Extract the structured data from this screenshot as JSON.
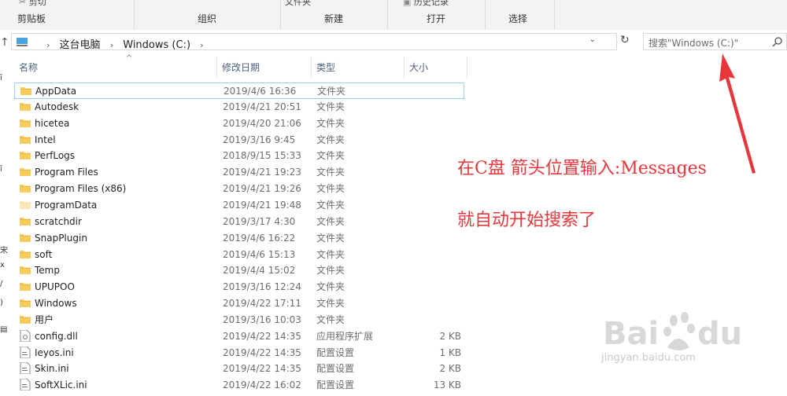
{
  "ribbon": {
    "groups": [
      {
        "label": "剪贴板",
        "top": "剪切"
      },
      {
        "label": "组织",
        "top": ""
      },
      {
        "label": "新建",
        "top": "文件夹"
      },
      {
        "label": "打开",
        "top": "历史记录"
      },
      {
        "label": "选择",
        "top": ""
      }
    ]
  },
  "address": {
    "crumbs": [
      "这台电脑",
      "Windows (C:)"
    ],
    "search_placeholder": "搜索\"Windows (C:)\""
  },
  "columns": {
    "name": "名称",
    "date": "修改日期",
    "type": "类型",
    "size": "大小"
  },
  "files": [
    {
      "name": "AppData",
      "date": "2019/4/6 16:36",
      "type": "文件夹",
      "size": "",
      "icon": "folder-icon"
    },
    {
      "name": "Autodesk",
      "date": "2019/4/21 20:51",
      "type": "文件夹",
      "size": "",
      "icon": "folder-icon"
    },
    {
      "name": "hicetea",
      "date": "2019/4/20 21:06",
      "type": "文件夹",
      "size": "",
      "icon": "folder-icon"
    },
    {
      "name": "Intel",
      "date": "2019/3/16 9:45",
      "type": "文件夹",
      "size": "",
      "icon": "folder-icon"
    },
    {
      "name": "PerfLogs",
      "date": "2018/9/15 15:33",
      "type": "文件夹",
      "size": "",
      "icon": "folder-icon"
    },
    {
      "name": "Program Files",
      "date": "2019/4/21 19:23",
      "type": "文件夹",
      "size": "",
      "icon": "folder-icon"
    },
    {
      "name": "Program Files (x86)",
      "date": "2019/4/21 19:26",
      "type": "文件夹",
      "size": "",
      "icon": "folder-icon"
    },
    {
      "name": "ProgramData",
      "date": "2019/4/21 19:48",
      "type": "文件夹",
      "size": "",
      "icon": "folder-icon"
    },
    {
      "name": "scratchdir",
      "date": "2019/3/17 4:30",
      "type": "文件夹",
      "size": "",
      "icon": "folder-icon"
    },
    {
      "name": "SnapPlugin",
      "date": "2019/4/6 16:22",
      "type": "文件夹",
      "size": "",
      "icon": "folder-icon"
    },
    {
      "name": "soft",
      "date": "2019/4/6 15:13",
      "type": "文件夹",
      "size": "",
      "icon": "folder-icon"
    },
    {
      "name": "Temp",
      "date": "2019/4/4 15:02",
      "type": "文件夹",
      "size": "",
      "icon": "folder-icon"
    },
    {
      "name": "UPUPOO",
      "date": "2019/3/16 12:24",
      "type": "文件夹",
      "size": "",
      "icon": "folder-icon"
    },
    {
      "name": "Windows",
      "date": "2019/4/22 17:11",
      "type": "文件夹",
      "size": "",
      "icon": "folder-icon"
    },
    {
      "name": "用户",
      "date": "2019/3/16 10:03",
      "type": "文件夹",
      "size": "",
      "icon": "folder-icon"
    },
    {
      "name": "config.dll",
      "date": "2019/4/22 14:35",
      "type": "应用程序扩展",
      "size": "2 KB",
      "icon": "dll-file-icon"
    },
    {
      "name": "Ieyos.ini",
      "date": "2019/4/22 14:35",
      "type": "配置设置",
      "size": "1 KB",
      "icon": "ini-file-icon"
    },
    {
      "name": "Skin.ini",
      "date": "2019/4/22 14:35",
      "type": "配置设置",
      "size": "2 KB",
      "icon": "ini-file-icon"
    },
    {
      "name": "SoftXLic.ini",
      "date": "2019/4/22 16:02",
      "type": "配置设置",
      "size": "13 KB",
      "icon": "ini-file-icon"
    }
  ],
  "annotation": {
    "line1": "在C盘 箭头位置输入:Messages",
    "line2": "就自动开始搜索了",
    "color": "#e8373b"
  },
  "watermark": {
    "text": "jingyan.baidu.com"
  },
  "colors": {
    "selection_border": "#99d1ff",
    "folder": "#f6cd5c",
    "header_text": "#4c607a"
  }
}
